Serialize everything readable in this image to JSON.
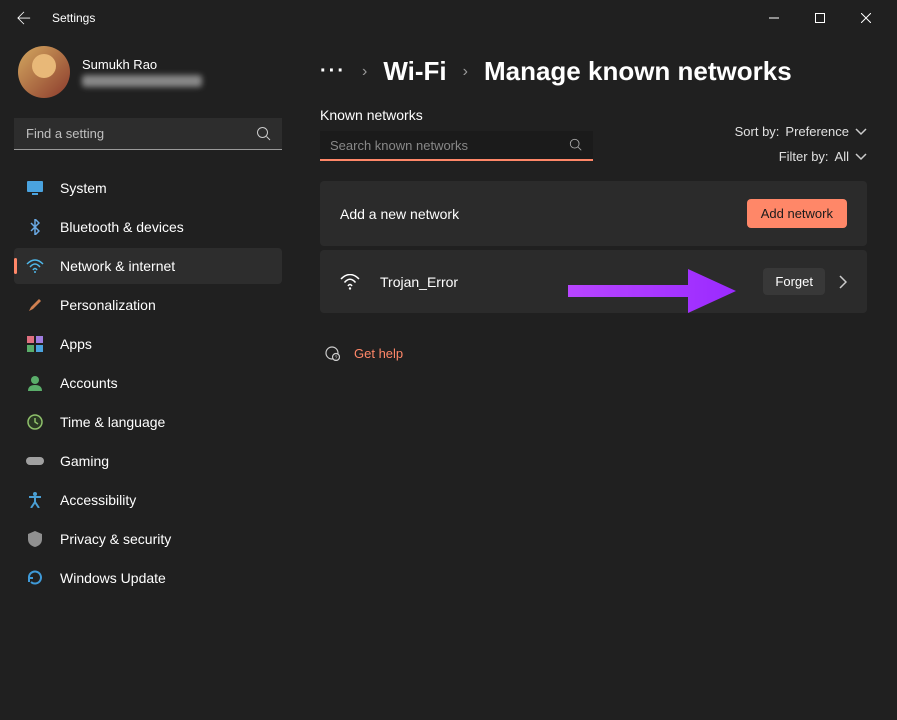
{
  "titlebar": {
    "title": "Settings"
  },
  "profile": {
    "name": "Sumukh Rao"
  },
  "search": {
    "placeholder": "Find a setting"
  },
  "sidebar": {
    "items": [
      {
        "label": "System",
        "icon": "system",
        "color": "#4aa3df"
      },
      {
        "label": "Bluetooth & devices",
        "icon": "bluetooth",
        "color": "#6aa9e4"
      },
      {
        "label": "Network & internet",
        "icon": "wifi",
        "color": "#4fb8eb",
        "active": true
      },
      {
        "label": "Personalization",
        "icon": "brush",
        "color": "#d08050"
      },
      {
        "label": "Apps",
        "icon": "apps",
        "color": "#e07080"
      },
      {
        "label": "Accounts",
        "icon": "person",
        "color": "#5aad6a"
      },
      {
        "label": "Time & language",
        "icon": "clock",
        "color": "#8fc16b"
      },
      {
        "label": "Gaming",
        "icon": "gamepad",
        "color": "#a0a0a0"
      },
      {
        "label": "Accessibility",
        "icon": "accessibility",
        "color": "#4a9fd4"
      },
      {
        "label": "Privacy & security",
        "icon": "shield",
        "color": "#909090"
      },
      {
        "label": "Windows Update",
        "icon": "update",
        "color": "#3f9ad8"
      }
    ]
  },
  "breadcrumb": {
    "parent": "Wi-Fi",
    "current": "Manage known networks"
  },
  "main": {
    "section_label": "Known networks",
    "search_placeholder": "Search known networks",
    "sort_label": "Sort by:",
    "sort_value": "Preference",
    "filter_label": "Filter by:",
    "filter_value": "All",
    "add_card_label": "Add a new network",
    "add_btn": "Add network",
    "network_name": "Trojan_Error",
    "forget_btn": "Forget",
    "help_link": "Get help"
  }
}
